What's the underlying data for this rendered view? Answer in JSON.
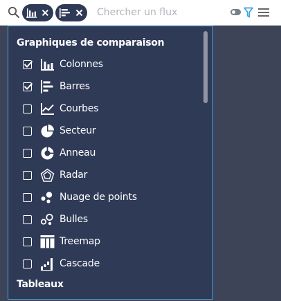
{
  "search": {
    "placeholder": "Chercher un flux",
    "value": "",
    "chips": [
      {
        "icon": "column-chart-icon"
      },
      {
        "icon": "bar-chart-icon"
      }
    ],
    "toggle_state": "off"
  },
  "dropdown": {
    "group_title": "Graphiques de comparaison",
    "next_group_title": "Tableaux",
    "items": [
      {
        "label": "Colonnes",
        "checked": true,
        "icon": "column-chart-icon"
      },
      {
        "label": "Barres",
        "checked": true,
        "icon": "bar-chart-icon"
      },
      {
        "label": "Courbes",
        "checked": false,
        "icon": "line-chart-icon"
      },
      {
        "label": "Secteur",
        "checked": false,
        "icon": "pie-chart-icon"
      },
      {
        "label": "Anneau",
        "checked": false,
        "icon": "donut-chart-icon"
      },
      {
        "label": "Radar",
        "checked": false,
        "icon": "radar-chart-icon"
      },
      {
        "label": "Nuage de points",
        "checked": false,
        "icon": "scatter-chart-icon"
      },
      {
        "label": "Bulles",
        "checked": false,
        "icon": "bubble-chart-icon"
      },
      {
        "label": "Treemap",
        "checked": false,
        "icon": "treemap-icon"
      },
      {
        "label": "Cascade",
        "checked": false,
        "icon": "waterfall-chart-icon"
      }
    ]
  },
  "colors": {
    "background": "#3d4458",
    "dropdown_bg": "#2f3a57",
    "dropdown_border": "#4aa3de",
    "chip_bg": "#2f3a57",
    "filter_accent": "#3aa4e0"
  }
}
